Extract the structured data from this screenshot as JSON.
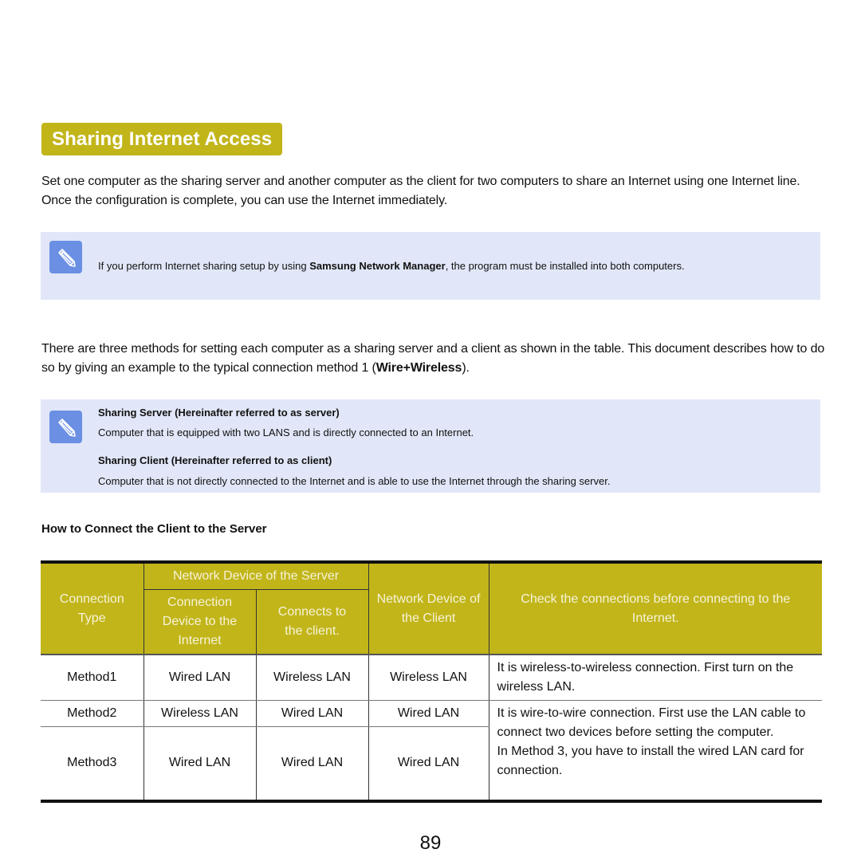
{
  "title": "Sharing Internet Access",
  "intro": "Set one computer as the sharing server and another computer as the client for two computers to share an Internet using one Internet line. Once the configuration is complete, you can use the Internet immediately.",
  "note1": {
    "icon": "pencil-icon",
    "text_before": "If you perform Internet sharing setup by using ",
    "text_bold": "Samsung Network Manager",
    "text_after": ", the program must be installed into both computers."
  },
  "methods_intro": {
    "text_before": "There are three methods for setting each computer as a sharing server and a client as shown in the table. This document describes how to do so by giving an example to the typical connection method 1 (",
    "text_bold": "Wire+Wireless",
    "text_after": ")."
  },
  "note2": {
    "icon": "pencil-icon",
    "server_term": "Sharing Server (Hereinafter referred to as server)",
    "server_desc": "Computer that is equipped with two LANS and is directly connected to an Internet.",
    "client_term": "Sharing Client (Hereinafter referred to as client)",
    "client_desc": "Computer that is not directly connected to the Internet and is able to use the Internet through the sharing server."
  },
  "section_heading": "How to Connect the Client to the Server",
  "table": {
    "headers": {
      "connection_type": "Connection Type",
      "server_group": "Network Device of the Server",
      "server_internet": "Connection Device to the Internet",
      "server_client": "Connects to the client.",
      "client_device": "Network Device of the Client",
      "check": "Check the connections before connecting to the Internet."
    },
    "rows": [
      {
        "method": "Method1",
        "internet": "Wired LAN",
        "to_client": "Wireless LAN",
        "client": "Wireless LAN",
        "note": "It is wireless-to-wireless connection. First turn on the wireless LAN."
      },
      {
        "method": "Method2",
        "internet": "Wireless LAN",
        "to_client": "Wired LAN",
        "client": "Wired LAN",
        "note": "It is wire-to-wire connection. First use the LAN cable to connect two devices before setting the computer."
      },
      {
        "method": "Method3",
        "internet": "Wired LAN",
        "to_client": "Wired LAN",
        "client": "Wired LAN",
        "note": "In Method 3, you have to install the wired LAN card for connection."
      }
    ]
  },
  "page_number": "89"
}
